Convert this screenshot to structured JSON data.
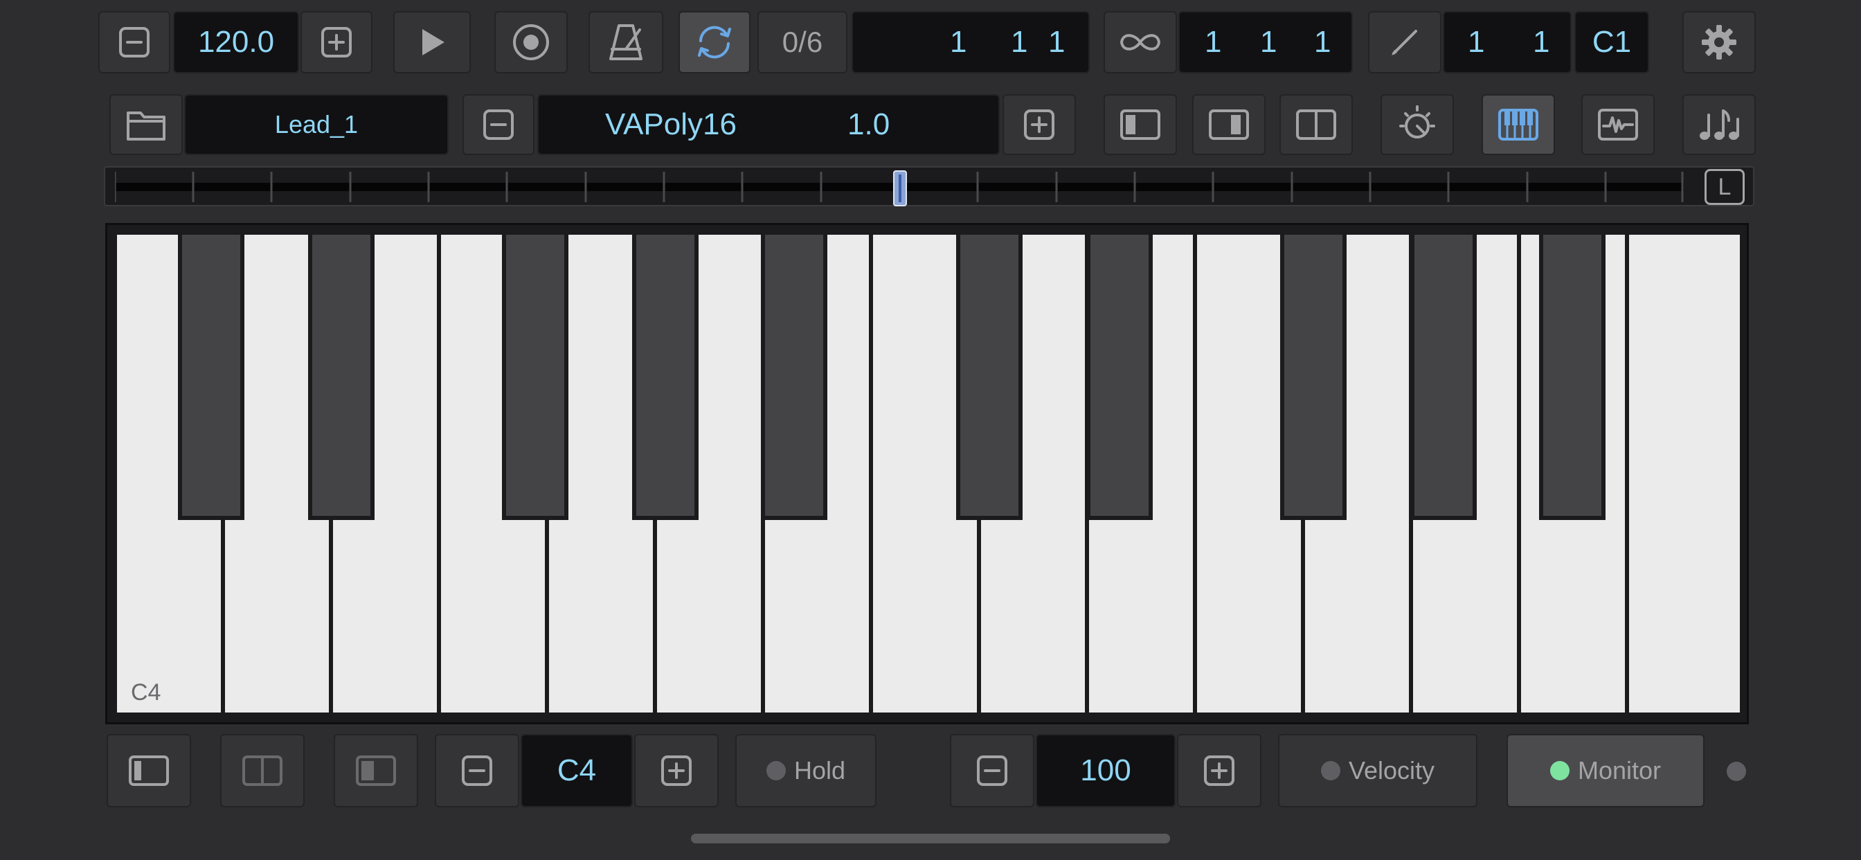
{
  "transport": {
    "tempo": "120.0",
    "loop_count": "0/6",
    "position": [
      "1",
      "1",
      "1"
    ],
    "loop_length": [
      "1",
      "1",
      "1"
    ],
    "edit_grid": [
      "1",
      "1"
    ],
    "edit_note": "C1"
  },
  "instrument": {
    "track_name": "Lead_1",
    "synth_name": "VAPoly16",
    "synth_value": "1.0"
  },
  "scrubber": {
    "lock_label": "L"
  },
  "keyboard": {
    "octave_label": "C4"
  },
  "bottom": {
    "octave_value": "C4",
    "hold_label": "Hold",
    "velocity_value": "100",
    "velocity_label": "Velocity",
    "monitor_label": "Monitor"
  },
  "colors": {
    "accent_blue": "#6aa8e6",
    "value_text": "#8fd6f5",
    "monitor_on": "#7fe3a0"
  }
}
